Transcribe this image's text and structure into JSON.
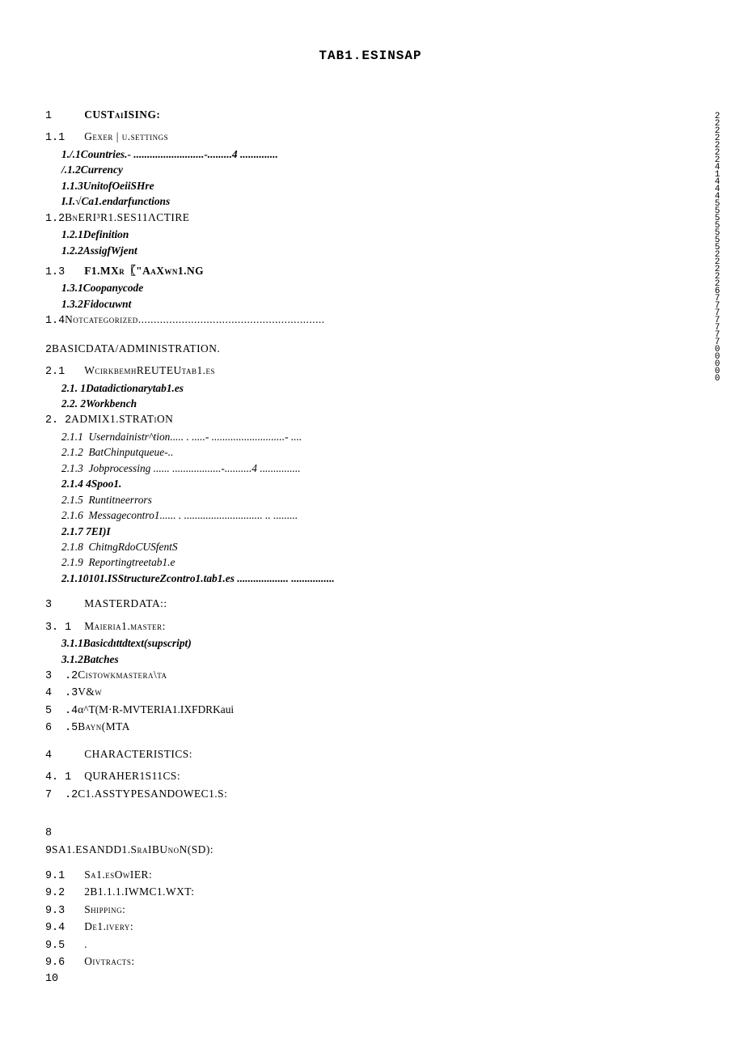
{
  "title": "TAB1.ESINSAP",
  "sidestrip": "2222222414445555555222226777777700000",
  "lines": [
    {
      "num": "1",
      "label": "CUSTaiISING:",
      "style": "smallcaps bold",
      "gap_before": 0
    },
    {
      "num": "1.1",
      "label": "Gexer | u.settings",
      "style": "smallcaps",
      "gap_before": 6
    },
    {
      "num": "",
      "label": "1./.1Countries.- ..........................-.........4 ..............",
      "style": "italic bold",
      "indent": 1,
      "nodots": true
    },
    {
      "num": "",
      "label": "/.1.2Currency ",
      "style": "italic bold",
      "indent": 1
    },
    {
      "num": "",
      "label": "1.1.3UnitofOeiiSHre ",
      "style": "italic bold",
      "indent": 1
    },
    {
      "num": "",
      "label": "I.I.√Ca1.endarfunctions ",
      "style": "italic bold",
      "indent": 1
    },
    {
      "num": "1.2",
      "label": "BnERI³R1.SES11ΛCTIRE ",
      "style": "smallcaps",
      "nospace": true
    },
    {
      "num": "",
      "label": "1.2.1Definition ",
      "style": "italic bold",
      "indent": 1
    },
    {
      "num": "",
      "label": "1.2.2AssigfWjent ",
      "style": "italic bold",
      "indent": 1
    },
    {
      "num": "1.3",
      "label": "F1.MXr〖\"AaXwn1.NG ",
      "style": "smallcaps bold",
      "gap_before": 6
    },
    {
      "num": "",
      "label": "1.3.1Coopanycode ",
      "style": "italic bold",
      "indent": 1
    },
    {
      "num": "",
      "label": "1.3.2Fidocuwnt ",
      "style": "italic bold",
      "indent": 1
    },
    {
      "num": "1.4",
      "label": "Notcategorized............................................................",
      "style": "smallcaps",
      "nospace": true,
      "nodots": true
    },
    {
      "num": "2",
      "label": "BASICDATA/ADMINISTRATION. ",
      "style": "smallcaps",
      "gap_before": 14,
      "nospace": true
    },
    {
      "num": "2.1",
      "label": "WcirkbemhREUTEUtab1.es ",
      "style": "smallcaps",
      "gap_before": 6
    },
    {
      "num": "",
      "label": "2.1. 1Datadictionarytab1.es ",
      "style": "italic bold",
      "indent": 1
    },
    {
      "num": "",
      "label": "2.2. 2Workbench ",
      "style": "italic bold",
      "indent": 1
    },
    {
      "num": "2. 2",
      "label": "ADMIX1.STRATiON ",
      "style": "smallcaps",
      "nospace": true
    },
    {
      "num": "",
      "label": "2.1.1  Userndainistr^tion..... . .....- ...........................- ....",
      "style": "italic",
      "indent": 1,
      "nodots": true
    },
    {
      "num": "",
      "label": "2.1.2  BatChinputqueue-.. ",
      "style": "italic",
      "indent": 1
    },
    {
      "num": "",
      "label": "2.1.3  Jobprocessing ...... ..................-..........4 ...............",
      "style": "italic",
      "indent": 1,
      "nodots": true
    },
    {
      "num": "",
      "label": "2.1.4 4Spoo1. ",
      "style": "italic bold",
      "indent": 1
    },
    {
      "num": "",
      "label": "2.1.5  Runtitneerrors ",
      "style": "italic",
      "indent": 1
    },
    {
      "num": "",
      "label": "2.1.6  Messagecontro1...... . ............................. .. .........",
      "style": "italic",
      "indent": 1,
      "nodots": true
    },
    {
      "num": "",
      "label": "2.1.7 7EI)I ",
      "style": "italic bold",
      "indent": 1
    },
    {
      "num": "",
      "label": "2.1.8  ChitngRdoCUSfentS ",
      "style": "italic",
      "indent": 1
    },
    {
      "num": "",
      "label": "2.1.9  Reportingtreetab1.e ",
      "style": "italic",
      "indent": 1
    },
    {
      "num": "",
      "label": "2.1.10101.ISStructureZcontro1.tab1.es ................... ................",
      "style": "italic bold",
      "indent": 1,
      "nodots": true
    },
    {
      "num": "3",
      "label": "MASTERDATA::",
      "style": "smallcaps",
      "gap_before": 12
    },
    {
      "num": "3. 1",
      "label": "Maieria1.master: ",
      "style": "smallcaps",
      "gap_before": 6
    },
    {
      "num": "",
      "label": "3.1.1Basicdıttdtext(supscript) ",
      "style": "italic bold",
      "indent": 1
    },
    {
      "num": "",
      "label": "3.1.2Batches ",
      "style": "italic bold",
      "indent": 1
    },
    {
      "num": "3  .2",
      "label": "Cistowkmasterʌ\\ta ",
      "style": "smallcaps",
      "nospace": true
    },
    {
      "num": "4  .3",
      "label": "V&w ",
      "style": "smallcaps",
      "nospace": true
    },
    {
      "num": "5  .4",
      "label": "α^T(M·R-MVTERIA1.IXFDRKaui ",
      "style": "",
      "nospace": true
    },
    {
      "num": "6  .5",
      "label": "Bayn(MTA ",
      "style": "smallcaps",
      "nospace": true
    },
    {
      "num": "4",
      "label": "CHARACTERISTICS: ",
      "style": "smallcaps",
      "gap_before": 12
    },
    {
      "num": "4. 1",
      "label": "QURAHER1S11CS:",
      "style": "smallcaps",
      "gap_before": 6
    },
    {
      "num": "7  .2",
      "label": "C1.ASSTYPESANDOWEC1.S: ",
      "style": "smallcaps",
      "nospace": true
    },
    {
      "num": "8",
      "label": "",
      "style": "",
      "gap_before": 28,
      "nodots": true
    },
    {
      "num": "9",
      "label": "SA1.ESANDD1.SraIBUnoN(SD):",
      "style": "smallcaps",
      "nospace": true
    },
    {
      "num": "9.1",
      "label": "Sa1.esOwIER: ",
      "style": "smallcaps",
      "gap_before": 10
    },
    {
      "num": "9.2",
      "label": "2B1.1.1.IWMC1.WXT: ",
      "style": "smallcaps"
    },
    {
      "num": "9.3",
      "label": "Shipping: ",
      "style": "smallcaps"
    },
    {
      "num": "9.4",
      "label": "De1.ivery: ",
      "style": "smallcaps"
    },
    {
      "num": "9.5",
      "label": ".",
      "style": "",
      "nodots": true
    },
    {
      "num": "9.6",
      "label": "Oivtracts: ",
      "style": "smallcaps"
    },
    {
      "num": "10",
      "label": "",
      "style": "",
      "nodots": true
    }
  ]
}
